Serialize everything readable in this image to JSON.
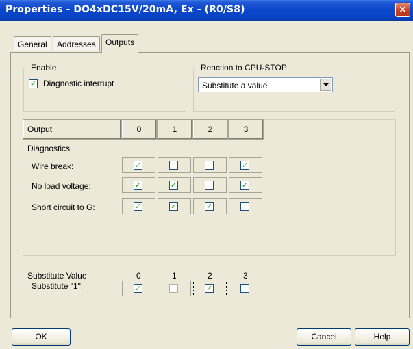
{
  "window": {
    "title": "Properties - DO4xDC15V/20mA, Ex - (R0/S8)",
    "close_glyph": "×"
  },
  "tabs": [
    {
      "label": "General"
    },
    {
      "label": "Addresses"
    },
    {
      "label": "Outputs"
    }
  ],
  "enable": {
    "legend": "Enable",
    "diagnostic_interrupt": {
      "label": "Diagnostic interrupt",
      "checked": true
    }
  },
  "reaction": {
    "legend": "Reaction to CPU-STOP",
    "selected": "Substitute a value"
  },
  "output_table": {
    "header": "Output",
    "columns": [
      "0",
      "1",
      "2",
      "3"
    ],
    "section": "Diagnostics",
    "rows": [
      {
        "label": "Wire break:",
        "values": [
          true,
          false,
          false,
          true
        ],
        "enabled": [
          true,
          true,
          true,
          true
        ]
      },
      {
        "label": "No load voltage:",
        "values": [
          true,
          true,
          false,
          true
        ],
        "enabled": [
          true,
          true,
          true,
          true
        ]
      },
      {
        "label": "Short circuit to G:",
        "values": [
          true,
          true,
          true,
          false
        ],
        "enabled": [
          true,
          true,
          true,
          true
        ]
      }
    ]
  },
  "substitute": {
    "legend": "Substitute Value",
    "row_label": "Substitute \"1\":",
    "columns": [
      "0",
      "1",
      "2",
      "3"
    ],
    "values": [
      true,
      false,
      true,
      false
    ],
    "enabled": [
      true,
      false,
      true,
      true
    ]
  },
  "buttons": {
    "ok": "OK",
    "cancel": "Cancel",
    "help": "Help"
  }
}
